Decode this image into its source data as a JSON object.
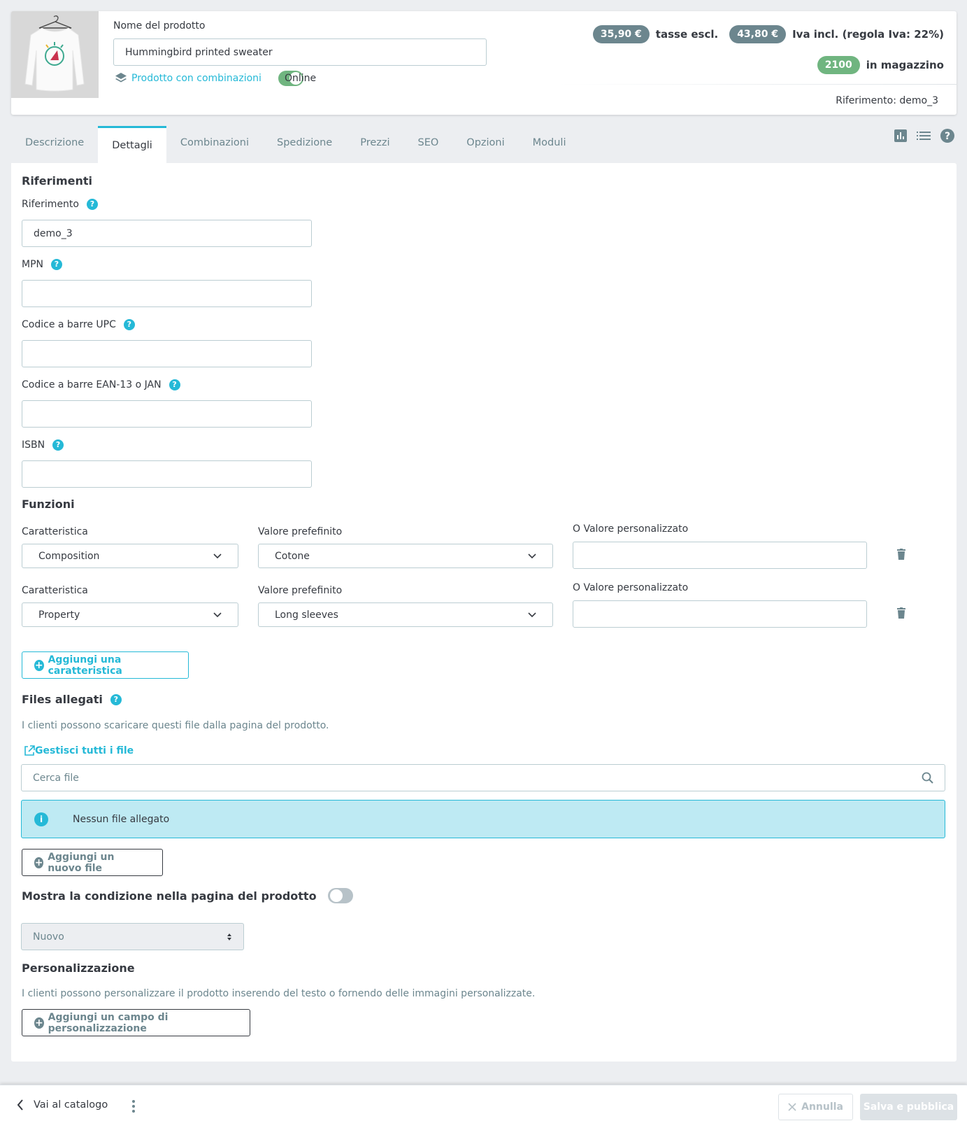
{
  "header": {
    "product_image_alt": "Hummingbird printed sweater",
    "name_label": "Nome del prodotto",
    "name_value": "Hummingbird printed sweater",
    "combinations_label": "Prodotto con combinazioni",
    "online_label": "Online",
    "online_enabled": true,
    "price_excl": "35,90 €",
    "price_excl_label": "tasse escl.",
    "price_incl": "43,80 €",
    "price_incl_label": "Iva incl. (regola Iva: 22%)",
    "stock": "2100",
    "stock_label": "in magazzino",
    "reference_line": "Riferimento: demo_3"
  },
  "tabs": [
    {
      "label": "Descrizione",
      "active": false
    },
    {
      "label": "Dettagli",
      "active": true
    },
    {
      "label": "Combinazioni",
      "active": false
    },
    {
      "label": "Spedizione",
      "active": false
    },
    {
      "label": "Prezzi",
      "active": false
    },
    {
      "label": "SEO",
      "active": false
    },
    {
      "label": "Opzioni",
      "active": false
    },
    {
      "label": "Moduli",
      "active": false
    }
  ],
  "tab_icons": [
    "bar-chart-icon",
    "list-icon",
    "help-icon"
  ],
  "references": {
    "title": "Riferimenti",
    "reference_label": "Riferimento",
    "reference_value": "demo_3",
    "mpn_label": "MPN",
    "mpn_value": "",
    "upc_label": "Codice a barre UPC",
    "upc_value": "",
    "ean_label": "Codice a barre EAN-13 o JAN",
    "ean_value": "",
    "isbn_label": "ISBN",
    "isbn_value": "",
    "help_glyph": "?"
  },
  "features": {
    "title": "Funzioni",
    "rows": [
      {
        "feature_label": "Caratteristica",
        "feature_value": "Composition",
        "preset_label": "Valore prefefinito",
        "preset_value": "Cotone",
        "custom_label": "O Valore personalizzato",
        "custom_value": ""
      },
      {
        "feature_label": "Caratteristica",
        "feature_value": "Property",
        "preset_label": "Valore prefefinito",
        "preset_value": "Long sleeves",
        "custom_label": "O Valore personalizzato",
        "custom_value": ""
      }
    ],
    "add_button": "Aggiungi una caratteristica"
  },
  "files": {
    "title": "Files allegati",
    "description": "I clienti possono scaricare questi file dalla pagina del prodotto.",
    "manage_link": "Gestisci tutti i file",
    "search_placeholder": "Cerca file",
    "alert_text": "Nessun file allegato",
    "add_button": "Aggiungi un nuovo file"
  },
  "condition": {
    "title": "Mostra la condizione nella pagina del prodotto",
    "enabled": false,
    "selected": "Nuovo"
  },
  "customization": {
    "title": "Personalizzazione",
    "description": "I clienti possono personalizzare il prodotto inserendo del testo o fornendo delle immagini personalizzate.",
    "add_button": "Aggiungi un campo di personalizzazione"
  },
  "footer": {
    "back_label": "Vai al catalogo",
    "cancel_label": "Annulla",
    "save_label": "Salva e pubblica"
  },
  "colors": {
    "accent": "#25b9d7",
    "success": "#70b580",
    "muted_pill": "#6c868e",
    "text": "#363a41",
    "background": "#eceef1",
    "info_bg": "#beeaf3"
  }
}
